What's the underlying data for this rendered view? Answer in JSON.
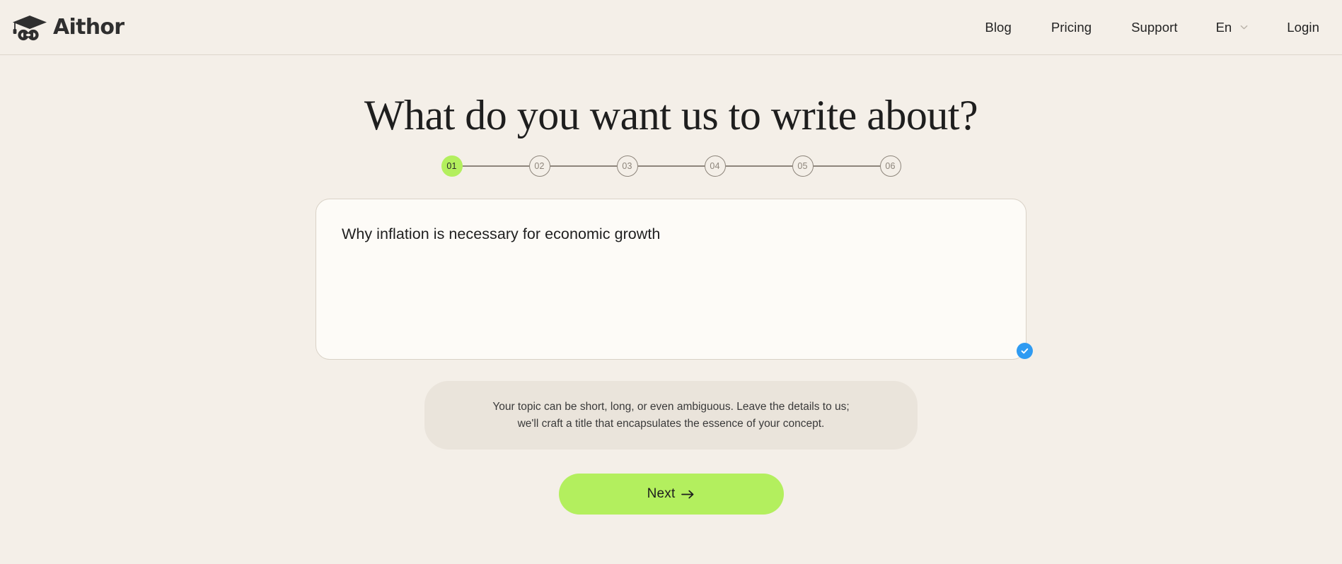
{
  "brand": {
    "name": "Aithor",
    "logo_icon": "graduation-cap-infinity-icon"
  },
  "header": {
    "nav": [
      {
        "label": "Blog",
        "name": "nav-item-blog"
      },
      {
        "label": "Pricing",
        "name": "nav-item-pricing"
      },
      {
        "label": "Support",
        "name": "nav-item-support"
      }
    ],
    "language": {
      "value": "En",
      "icon": "chevron-down-icon"
    },
    "login_label": "Login"
  },
  "main": {
    "title": "What do you want us to write about?",
    "stepper": {
      "active_index": 0,
      "steps": [
        "01",
        "02",
        "03",
        "04",
        "05",
        "06"
      ],
      "active_color": "#b3ef5e",
      "inactive_color": "#8d857b"
    },
    "topic_input": {
      "value": "Why inflation is necessary for economic growth",
      "placeholder": "Type your topic here",
      "valid_icon": "check-circle-icon",
      "valid_color": "#2f9bf2"
    },
    "hint": {
      "line1": "Your topic can be short, long, or even ambiguous. Leave the details to us;",
      "line2": "we'll craft a title that encapsulates the essence of your concept."
    },
    "next_button": {
      "label": "Next",
      "icon": "arrow-right-icon",
      "color": "#b3ef5e"
    }
  },
  "theme": {
    "page_background": "#f4efe8",
    "card_background": "#fdfbf7",
    "hint_background": "#eae4db",
    "text_color": "#1f1f1f"
  }
}
